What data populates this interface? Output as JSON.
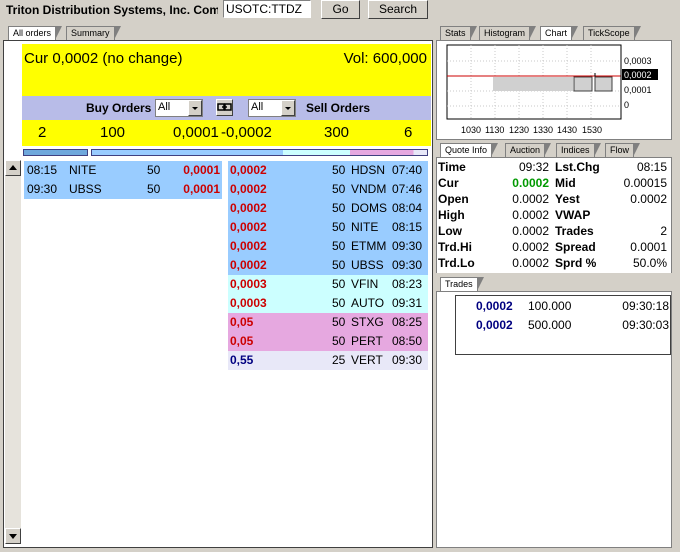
{
  "header": {
    "company": "Triton Distribution Systems, Inc.  Com",
    "symbol_value": "USOTC:TTDZ",
    "go_label": "Go",
    "search_label": "Search"
  },
  "left_tabs": [
    "All orders",
    "Summary"
  ],
  "banner": {
    "current": "Cur 0,0002 (no change)",
    "volume": "Vol: 600,000"
  },
  "filter": {
    "buy_label": "Buy Orders",
    "buy_value": "All",
    "sell_value": "All",
    "sell_label": "Sell Orders"
  },
  "summary": {
    "buy_count": "2",
    "buy_volume": "100",
    "buy_price": "0,0001",
    "sell_price": "-0,0002",
    "sell_volume": "300",
    "sell_count": "6"
  },
  "buy_orders": [
    {
      "time": "08:15",
      "mm": "NITE",
      "size": "50",
      "price": "0,0001"
    },
    {
      "time": "09:30",
      "mm": "UBSS",
      "size": "50",
      "price": "0,0001"
    }
  ],
  "sell_orders": [
    {
      "price": "0,0002",
      "size": "50",
      "mm": "HDSN",
      "time": "07:40",
      "color": "#99ccff"
    },
    {
      "price": "0,0002",
      "size": "50",
      "mm": "VNDM",
      "time": "07:46",
      "color": "#99ccff"
    },
    {
      "price": "0,0002",
      "size": "50",
      "mm": "DOMS",
      "time": "08:04",
      "color": "#99ccff"
    },
    {
      "price": "0,0002",
      "size": "50",
      "mm": "NITE",
      "time": "08:15",
      "color": "#99ccff"
    },
    {
      "price": "0,0002",
      "size": "50",
      "mm": "ETMM",
      "time": "09:30",
      "color": "#99ccff"
    },
    {
      "price": "0,0002",
      "size": "50",
      "mm": "UBSS",
      "time": "09:30",
      "color": "#99ccff"
    },
    {
      "price": "0,0003",
      "size": "50",
      "mm": "VFIN",
      "time": "08:23",
      "color": "#ccffff"
    },
    {
      "price": "0,0003",
      "size": "50",
      "mm": "AUTO",
      "time": "09:31",
      "color": "#ccffff"
    },
    {
      "price": "0,05",
      "size": "50",
      "mm": "STXG",
      "time": "08:25",
      "color": "#e6a8e0"
    },
    {
      "price": "0,05",
      "size": "50",
      "mm": "PERT",
      "time": "08:50",
      "color": "#e6a8e0"
    },
    {
      "price": "0,55",
      "size": "25",
      "mm": "VERT",
      "time": "09:30",
      "color": "#e8e8f8"
    }
  ],
  "right_top_tabs": [
    "Stats",
    "Histogram",
    "Chart",
    "TickScope"
  ],
  "chart": {
    "y_labels": [
      "0,0003",
      "0,0002",
      "0,0001",
      "0"
    ],
    "x_labels": [
      "1030",
      "1130",
      "1230",
      "1330",
      "1430",
      "1530"
    ]
  },
  "right_mid_tabs": [
    "Quote Info",
    "Auction",
    "Indices",
    "Flow"
  ],
  "quote_info": [
    {
      "l1": "Time",
      "v1": "09:32",
      "l2": "Lst.Chg",
      "v2": "08:15"
    },
    {
      "l1": "Cur",
      "v1": "0.0002",
      "l2": "Mid",
      "v2": "0.00015"
    },
    {
      "l1": "Open",
      "v1": "0.0002",
      "l2": "Yest",
      "v2": "0.0002"
    },
    {
      "l1": "High",
      "v1": "0.0002",
      "l2": "VWAP",
      "v2": ""
    },
    {
      "l1": "Low",
      "v1": "0.0002",
      "l2": "Trades",
      "v2": "2"
    },
    {
      "l1": "Trd.Hi",
      "v1": "0.0002",
      "l2": "Spread",
      "v2": "0.0001"
    },
    {
      "l1": "Trd.Lo",
      "v1": "0.0002",
      "l2": "Sprd %",
      "v2": "50.0%"
    }
  ],
  "trades_tab": "Trades",
  "trades": [
    {
      "price": "0,0002",
      "volume": "100.000",
      "time": "09:30:18"
    },
    {
      "price": "0,0002",
      "volume": "500.000",
      "time": "09:30:03"
    }
  ],
  "colors": {
    "banner_yellow": "#ffff00",
    "filter_bar": "#b8bce8",
    "buy_row": "#99ccff",
    "cur_green": "#009900"
  }
}
